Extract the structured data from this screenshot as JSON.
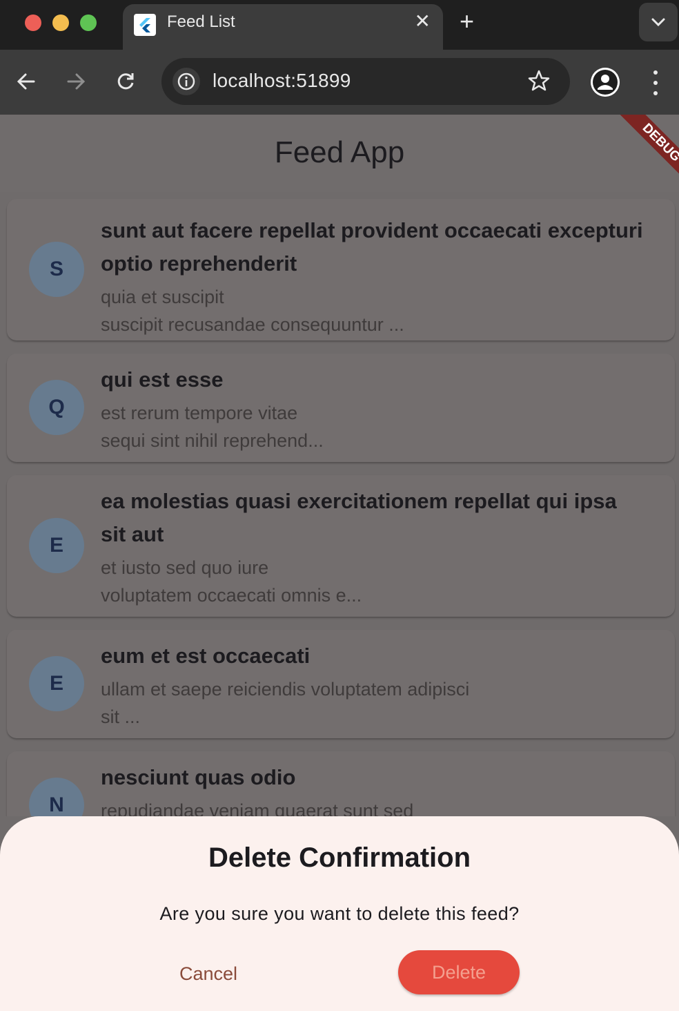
{
  "browser": {
    "tab_title": "Feed List",
    "url": "localhost:51899"
  },
  "app": {
    "title": "Feed App",
    "debug_banner": "DEBUG"
  },
  "feeds": [
    {
      "initial": "S",
      "title": "sunt aut facere repellat provident occaecati excepturi optio reprehenderit",
      "body_line1": "quia et suscipit",
      "body_line2": "suscipit recusandae consequuntur ..."
    },
    {
      "initial": "Q",
      "title": "qui est esse",
      "body_line1": "est rerum tempore vitae",
      "body_line2": "sequi sint nihil reprehend..."
    },
    {
      "initial": "E",
      "title": "ea molestias quasi exercitationem repellat qui ipsa sit aut",
      "body_line1": "et iusto sed quo iure",
      "body_line2": "voluptatem occaecati omnis e..."
    },
    {
      "initial": "E",
      "title": "eum et est occaecati",
      "body_line1": "ullam et saepe reiciendis voluptatem adipisci",
      "body_line2": "sit ..."
    },
    {
      "initial": "N",
      "title": "nesciunt quas odio",
      "body_line1": "repudiandae veniam quaerat sunt sed",
      "body_line2": ""
    }
  ],
  "dialog": {
    "title": "Delete Confirmation",
    "message": "Are you sure you want to delete this feed?",
    "cancel_label": "Cancel",
    "delete_label": "Delete"
  },
  "colors": {
    "scrim": "#6f6b6b",
    "sheet_background": "#fcf1ee",
    "delete_button": "#e5493d",
    "cancel_text": "#8a4b3a",
    "debug_ribbon": "#7d2522"
  },
  "icons": [
    "flutter-favicon-icon",
    "close-icon",
    "plus-icon",
    "chevron-down-icon",
    "back-arrow-icon",
    "forward-arrow-icon",
    "reload-icon",
    "info-icon",
    "star-icon",
    "profile-icon",
    "more-vert-icon"
  ]
}
